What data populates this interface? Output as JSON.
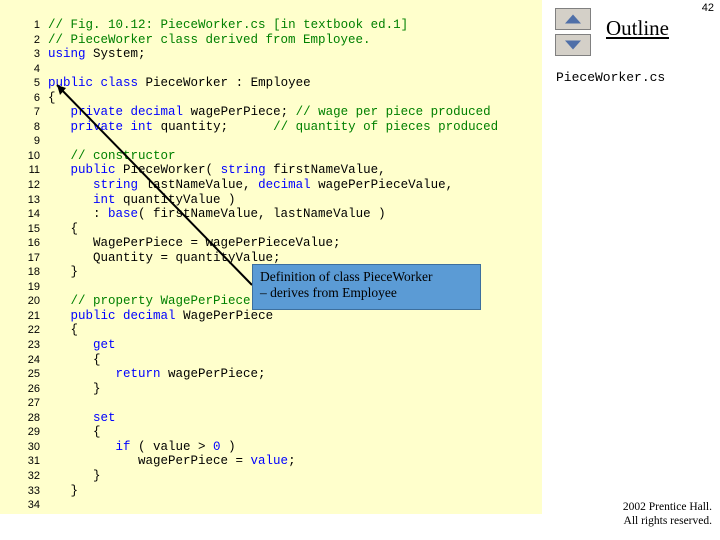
{
  "page_number": "42",
  "code": {
    "line_numbers": [
      "1",
      "2",
      "3",
      "4",
      "5",
      "6",
      "7",
      "8",
      "9",
      "10",
      "11",
      "12",
      "13",
      "14",
      "15",
      "16",
      "17",
      "18",
      "19",
      "20",
      "21",
      "22",
      "23",
      "24",
      "25",
      "26",
      "27",
      "28",
      "29",
      "30",
      "31",
      "32",
      "33",
      "34"
    ],
    "lines": [
      [
        {
          "t": "// Fig. 10.12: ",
          "c": "green"
        },
        {
          "t": "PieceWorker.cs",
          "c": "green"
        },
        {
          "t": " [in textbook ed.1]",
          "c": "green"
        }
      ],
      [
        {
          "t": "// PieceWorker class derived from Employee.",
          "c": "green"
        }
      ],
      [
        {
          "t": "using",
          "c": "blue"
        },
        {
          "t": " System;",
          "c": "black"
        }
      ],
      [],
      [
        {
          "t": "public",
          "c": "blue"
        },
        {
          "t": " ",
          "c": "black"
        },
        {
          "t": "class",
          "c": "blue"
        },
        {
          "t": " PieceWorker : Employee",
          "c": "black"
        }
      ],
      [
        {
          "t": "{",
          "c": "black"
        }
      ],
      [
        {
          "t": "   ",
          "c": "black"
        },
        {
          "t": "private",
          "c": "blue"
        },
        {
          "t": " ",
          "c": "black"
        },
        {
          "t": "decimal",
          "c": "blue"
        },
        {
          "t": " wagePerPiece; ",
          "c": "black"
        },
        {
          "t": "// wage per piece produced",
          "c": "green"
        }
      ],
      [
        {
          "t": "   ",
          "c": "black"
        },
        {
          "t": "private",
          "c": "blue"
        },
        {
          "t": " ",
          "c": "black"
        },
        {
          "t": "int",
          "c": "blue"
        },
        {
          "t": " quantity;      ",
          "c": "black"
        },
        {
          "t": "// quantity of pieces produced",
          "c": "green"
        }
      ],
      [],
      [
        {
          "t": "   ",
          "c": "black"
        },
        {
          "t": "// constructor",
          "c": "green"
        }
      ],
      [
        {
          "t": "   ",
          "c": "black"
        },
        {
          "t": "public",
          "c": "blue"
        },
        {
          "t": " PieceWorker( ",
          "c": "black"
        },
        {
          "t": "string",
          "c": "blue"
        },
        {
          "t": " firstNameValue,",
          "c": "black"
        }
      ],
      [
        {
          "t": "      ",
          "c": "black"
        },
        {
          "t": "string",
          "c": "blue"
        },
        {
          "t": " lastNameValue, ",
          "c": "black"
        },
        {
          "t": "decimal",
          "c": "blue"
        },
        {
          "t": " wagePerPieceValue,",
          "c": "black"
        }
      ],
      [
        {
          "t": "      ",
          "c": "black"
        },
        {
          "t": "int",
          "c": "blue"
        },
        {
          "t": " quantityValue )",
          "c": "black"
        }
      ],
      [
        {
          "t": "      : ",
          "c": "black"
        },
        {
          "t": "base",
          "c": "blue"
        },
        {
          "t": "( firstNameValue, lastNameValue )",
          "c": "black"
        }
      ],
      [
        {
          "t": "   {",
          "c": "black"
        }
      ],
      [
        {
          "t": "      WagePerPiece = wagePerPieceValue;",
          "c": "black"
        }
      ],
      [
        {
          "t": "      Quantity = quantityValue;",
          "c": "black"
        }
      ],
      [
        {
          "t": "   }",
          "c": "black"
        }
      ],
      [],
      [
        {
          "t": "   ",
          "c": "black"
        },
        {
          "t": "// property WagePerPiece",
          "c": "green"
        }
      ],
      [
        {
          "t": "   ",
          "c": "black"
        },
        {
          "t": "public",
          "c": "blue"
        },
        {
          "t": " ",
          "c": "black"
        },
        {
          "t": "decimal",
          "c": "blue"
        },
        {
          "t": " WagePerPiece",
          "c": "black"
        }
      ],
      [
        {
          "t": "   {",
          "c": "black"
        }
      ],
      [
        {
          "t": "      ",
          "c": "black"
        },
        {
          "t": "get",
          "c": "blue"
        }
      ],
      [
        {
          "t": "      {",
          "c": "black"
        }
      ],
      [
        {
          "t": "         ",
          "c": "black"
        },
        {
          "t": "return",
          "c": "blue"
        },
        {
          "t": " wagePerPiece;",
          "c": "black"
        }
      ],
      [
        {
          "t": "      }",
          "c": "black"
        }
      ],
      [],
      [
        {
          "t": "      ",
          "c": "black"
        },
        {
          "t": "set",
          "c": "blue"
        }
      ],
      [
        {
          "t": "      {",
          "c": "black"
        }
      ],
      [
        {
          "t": "         ",
          "c": "black"
        },
        {
          "t": "if",
          "c": "blue"
        },
        {
          "t": " ( value > ",
          "c": "black"
        },
        {
          "t": "0",
          "c": "blue"
        },
        {
          "t": " )",
          "c": "black"
        }
      ],
      [
        {
          "t": "            wagePerPiece = ",
          "c": "black"
        },
        {
          "t": "value",
          "c": "blue"
        },
        {
          "t": ";",
          "c": "black"
        }
      ],
      [
        {
          "t": "      }",
          "c": "black"
        }
      ],
      [
        {
          "t": "   }",
          "c": "black"
        }
      ],
      []
    ]
  },
  "callout": {
    "line1": "Definition of class PieceWorker",
    "line2": "– derives from Employee",
    "background_color": "#5b9bd5"
  },
  "right_rail": {
    "outline_title": "Outline",
    "file_name": "PieceWorker.cs",
    "scroll_up_label": "▲",
    "scroll_down_label": "▼"
  },
  "footer": {
    "line1": " 2002 Prentice Hall.",
    "line2": "All rights reserved."
  },
  "colors": {
    "code_background": "#ffffcc",
    "comment": "#008000",
    "keyword": "#0000ff",
    "plain": "#000000"
  }
}
